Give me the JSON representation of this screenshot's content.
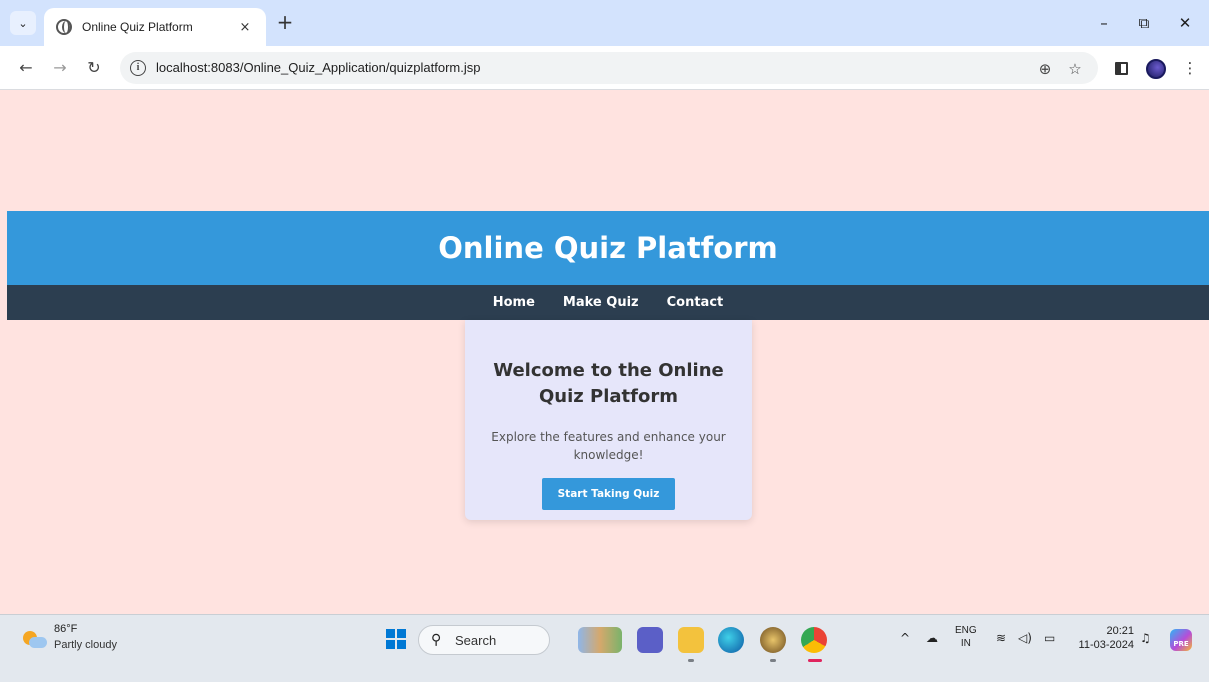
{
  "browser": {
    "tab_title": "Online Quiz Platform",
    "tab_close": "×",
    "new_tab": "+",
    "url": "localhost:8083/Online_Quiz_Application/quizplatform.jsp",
    "controls": {
      "minimize": "–",
      "restore": "⧉",
      "close": "✕"
    }
  },
  "page": {
    "title": "Online Quiz Platform",
    "nav": [
      {
        "label": "Home"
      },
      {
        "label": "Make Quiz"
      },
      {
        "label": "Contact"
      }
    ],
    "card": {
      "heading": "Welcome to the Online Quiz Platform",
      "text": "Explore the features and enhance your knowledge!",
      "button": "Start Taking Quiz"
    }
  },
  "taskbar": {
    "weather": {
      "temp": "86°F",
      "condition": "Partly cloudy"
    },
    "search_label": "Search",
    "lang": {
      "line1": "ENG",
      "line2": "IN"
    },
    "time": "20:21",
    "date": "11-03-2024"
  },
  "colors": {
    "page_bg": "#ffe3e0",
    "header_bg": "#3498db",
    "nav_bg": "#2c3e50",
    "card_bg": "#e6e6fa",
    "button_bg": "#3498db"
  },
  "icons": [
    "tab-search-icon",
    "globe-icon",
    "back-icon",
    "forward-icon",
    "reload-icon",
    "site-info-icon",
    "zoom-icon",
    "bookmark-star-icon",
    "side-panel-icon",
    "profile-avatar",
    "menu-kebab-icon",
    "weather-icon",
    "windows-start-icon",
    "search-icon"
  ]
}
